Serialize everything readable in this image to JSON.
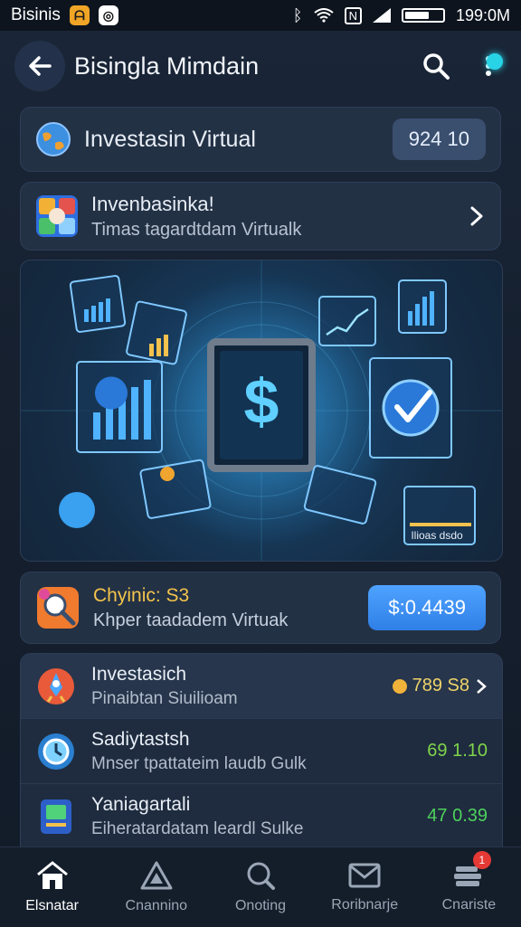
{
  "status_bar": {
    "carrier": "Bisinis",
    "time": "199:0M",
    "icons": [
      "notification-orange-icon",
      "notification-white-icon",
      "bluetooth-icon",
      "wifi-icon",
      "nfc-icon",
      "signal-icon",
      "battery-icon"
    ]
  },
  "header": {
    "title": "Bisingla Mimdain",
    "icons": [
      "back-arrow-icon",
      "search-icon",
      "more-icon"
    ]
  },
  "card_virtual": {
    "title": "Investasin Virtual",
    "value": "924 10",
    "icon": "globe-icon"
  },
  "card_info": {
    "title": "Invenbasinka!",
    "subtitle": "Timas tagardtdam Virtualk",
    "icon": "puzzle-app-icon"
  },
  "hero": {
    "description_icon": "finance-dashboard-illustration",
    "label": "Ilioas dsdo"
  },
  "card_balance": {
    "title": "Chyinic: S3",
    "subtitle": "Khper taadadem Virtuak",
    "value": "$:0.4439",
    "icon": "magnifier-app-icon"
  },
  "list": {
    "rows": [
      {
        "title": "Investasich",
        "subtitle": "Pinaibtan Siuilioam",
        "value": "789 S8",
        "icon": "rocket-icon",
        "value_color": "#f0b23a"
      },
      {
        "title": "Sadiytastsh",
        "subtitle": "Mnser tpattateim laudb Gulk",
        "value": "69 1.10",
        "icon": "timer-icon",
        "value_color": "#7fd44a"
      },
      {
        "title": "Yaniagartali",
        "subtitle": "Eiheratardatam leardl Sulke",
        "value": "47 0.39",
        "icon": "book-icon",
        "value_color": "#4ed15c"
      }
    ]
  },
  "bottom_nav": {
    "items": [
      {
        "label": "Elsnatar",
        "icon": "home-icon",
        "active": true
      },
      {
        "label": "Cnannino",
        "icon": "warning-triangle-icon",
        "active": false
      },
      {
        "label": "Onoting",
        "icon": "search-icon",
        "active": false
      },
      {
        "label": "Roribnarje",
        "icon": "mail-icon",
        "active": false
      },
      {
        "label": "Cnariste",
        "icon": "stack-icon",
        "active": false,
        "badge": "1"
      }
    ]
  },
  "colors": {
    "accent_blue": "#3b8ff0",
    "cyan": "#29d3e6",
    "gold": "#f4c44b",
    "green": "#4ed15c"
  }
}
